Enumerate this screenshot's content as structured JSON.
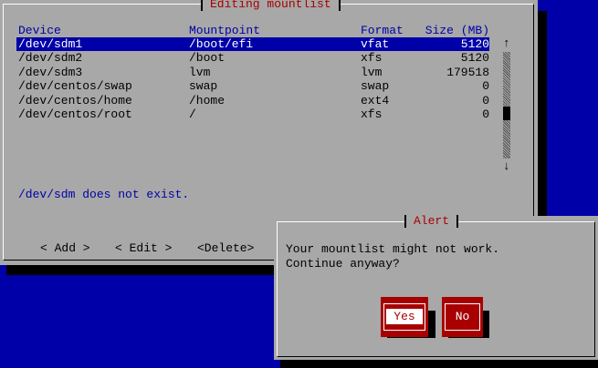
{
  "dialog": {
    "title": "Editing mountlist",
    "columns": [
      "Device",
      "Mountpoint",
      "Format",
      "Size (MB)"
    ],
    "rows": [
      {
        "device": "/dev/sdm1",
        "mountpoint": "/boot/efi",
        "format": "vfat",
        "size": "5120",
        "selected": true
      },
      {
        "device": "/dev/sdm2",
        "mountpoint": "/boot",
        "format": "xfs",
        "size": "5120"
      },
      {
        "device": "/dev/sdm3",
        "mountpoint": "lvm",
        "format": "lvm",
        "size": "179518"
      },
      {
        "device": "/dev/centos/swap",
        "mountpoint": "swap",
        "format": "swap",
        "size": "0"
      },
      {
        "device": "/dev/centos/home",
        "mountpoint": "/home",
        "format": "ext4",
        "size": "0"
      },
      {
        "device": "/dev/centos/root",
        "mountpoint": "/",
        "format": "xfs",
        "size": "0"
      }
    ],
    "scroll_up": "↑",
    "scroll_down": "↓",
    "message": "/dev/sdm does not exist.",
    "buttons": {
      "add": "< Add >",
      "edit": "< Edit >",
      "delete": "<Delete>"
    }
  },
  "alert": {
    "title": "Alert",
    "line1": "Your mountlist might not work.",
    "line2": "Continue anyway?",
    "yes": "Yes",
    "no": "No"
  }
}
